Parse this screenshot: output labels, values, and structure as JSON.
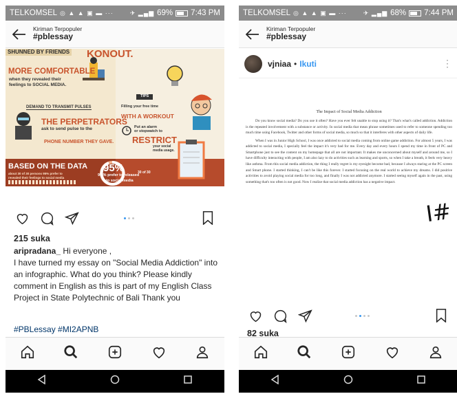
{
  "status": {
    "carrier": "TELKOMSEL",
    "left": {
      "battery_pct": "69%",
      "battery_level": 0.69,
      "time": "7:43 PM"
    },
    "right": {
      "battery_pct": "68%",
      "battery_level": 0.68,
      "time": "7:44 PM"
    }
  },
  "header": {
    "subtitle": "Kiriman Terpopuler",
    "title": "#pblessay"
  },
  "left_post": {
    "infographic": {
      "shunned": "SHUNNED BY FRIENDS",
      "more": "MORE COMFORTABLE",
      "when1": "when they revealed their",
      "when2": "feelings to SOCIAL MEDIA.",
      "demand": "DEMAND TO TRANSMIT PULSES",
      "perp": "THE PERPETRATORS",
      "ask1": "ask to send pulse to the",
      "ask2": "",
      "phone": "PHONE NUMBER THEY GAVE.",
      "knockout": "KONOUT.",
      "tips": "TIPS",
      "filling1": "Filling your free time",
      "filling2": "",
      "workout": "WITH A WORKOUT",
      "alarm1": "Put an alarm",
      "alarm2": "or stopwatch to",
      "restrict": "RESTRICT",
      "your1": "your social",
      "your2": "media usage.",
      "based": "BASED ON THE DATA",
      "about1": "about 30 of 30 persons 95% prefer to",
      "about2": "revealed their feelings to social media",
      "pct": "95%",
      "thirty": "30 of 30",
      "prefer1": "95 % prefer to released",
      "prefer2": "to social media"
    },
    "likes": "215 suka",
    "caption_user": "aripradana_",
    "caption_text": "Hi everyone ,",
    "caption_body": "I have turned my essay on \"Social Media Addiction\" into an infographic. What do you think? Please kindly comment in English as this is part of my English Class Project in State Polytechnic of Bali Thank you",
    "hashtags": "#PBLessay #MI2APNB"
  },
  "right_post": {
    "username": "vjniaa",
    "follow": "Ikuti",
    "doc_title": "The Impact of Social Media Addiction",
    "para1": "Do you know social media? Do you use it often? Have you ever felt unable to stop using it? That's what's called addiction. Addiction is the repeated involvement with a substance or activity. In social media that mean phrase sometimes used to refer to someone spending too much time using Facebook, Twitter and other forms of social media, so much so that it interferes with other aspects of daily life.",
    "para2": "When I was in Junior High School, I was once addicted to social media coming from online game addiction. For almost 5 years, I was addicted to social media, I specially feel the impact it's very bad for me. Every day and every hours I spend my time in front of PC and Smartphone just to see the content on my homepage that all are not important. It makes me unconcerned about myself and around me, so I have difficulty interacting with people, I am also lazy to do activities such as learning and sports, so when I take a breath, it feels very heavy like asthma. From this social media addiction, the thing I really regret is my eyesight become bad, because I always staring at the PC screen and Smart phone. I started thinking, I can't be like this forever. I started focusing on the real world to achieve my dreams. I did positive activities to avoid playing social media for too long, and finally I was not addicted anymore. I started seeing myself again in the past, using something that's too often is not good. Now I realize that social media addiction has a negative impact.",
    "hashmark": "I#",
    "likes": "82 suka"
  },
  "icons": {
    "back": "arrow-left-icon",
    "like": "heart-icon",
    "comment": "comment-icon",
    "share": "send-icon",
    "save": "bookmark-icon",
    "home": "home-icon",
    "search": "search-icon",
    "add": "add-post-icon",
    "activity": "heart-icon",
    "profile": "profile-icon"
  },
  "colors": {
    "accent_blue": "#3897f0",
    "hashtag": "#003569",
    "infographic_red": "#c8532c"
  }
}
